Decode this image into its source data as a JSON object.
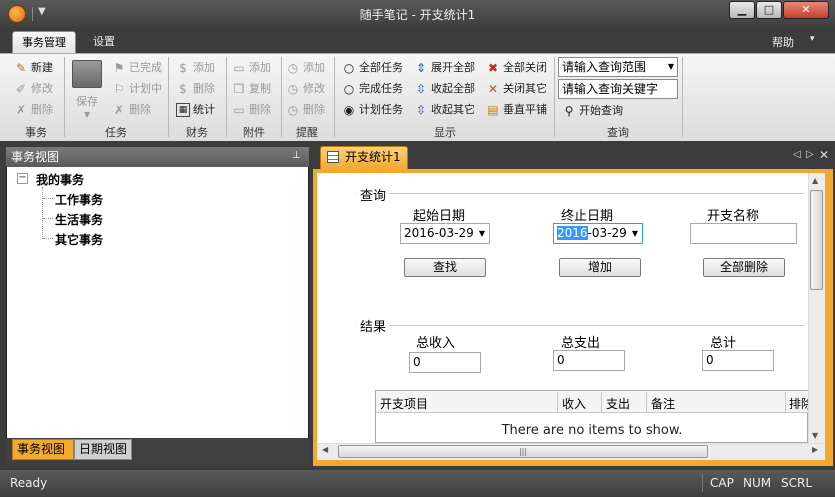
{
  "window": {
    "title": "随手笔记 - 开支统计1"
  },
  "ribbon": {
    "tabs": [
      "事务管理",
      "设置"
    ],
    "help": "帮助",
    "groups": {
      "events": {
        "label": "事务",
        "items": [
          "新建",
          "修改",
          "删除"
        ]
      },
      "tasks": {
        "label": "任务",
        "save": "保存",
        "items": [
          "已完成",
          "计划中",
          "删除"
        ]
      },
      "finance": {
        "label": "财务",
        "items": [
          "添加",
          "删除",
          "统计"
        ]
      },
      "attachments": {
        "label": "附件",
        "items": [
          "添加",
          "复制",
          "删除"
        ]
      },
      "reminders": {
        "label": "提醒",
        "items": [
          "添加",
          "修改",
          "删除"
        ]
      },
      "display": {
        "label": "显示",
        "radios": [
          "全部任务",
          "完成任务",
          "计划任务"
        ],
        "expand": [
          "展开全部",
          "收起全部",
          "收起其它"
        ],
        "window": [
          "全部关闭",
          "关闭其它",
          "垂直平铺"
        ]
      },
      "query": {
        "label": "查询",
        "range_placeholder": "请输入查询范围",
        "keyword_placeholder": "请输入查询关键字",
        "start_query": "开始查询"
      }
    }
  },
  "left_panel": {
    "title": "事务视图",
    "tree": {
      "root": "我的事务",
      "children": [
        "工作事务",
        "生活事务",
        "其它事务"
      ]
    },
    "tabs": [
      "事务视图",
      "日期视图"
    ]
  },
  "document": {
    "tab_title": "开支统计1",
    "query_section": {
      "title": "查询",
      "start_date_label": "起始日期",
      "start_date": "2016-03-29",
      "end_date_label": "终止日期",
      "end_date_year": "2016",
      "end_date_rest": "-03-29",
      "expense_name_label": "开支名称",
      "expense_name_value": "",
      "buttons": [
        "查找",
        "增加",
        "全部删除"
      ]
    },
    "result_section": {
      "title": "结果",
      "total_income_label": "总收入",
      "total_income": "0",
      "total_expense_label": "总支出",
      "total_expense": "0",
      "total_label": "总计",
      "total": "0"
    },
    "grid": {
      "columns": [
        "开支项目",
        "收入",
        "支出",
        "备注",
        "排除"
      ],
      "empty_message": "There are no items to show."
    }
  },
  "statusbar": {
    "text": "Ready",
    "indicators": [
      "CAP",
      "NUM",
      "SCRL"
    ]
  },
  "colors": {
    "accent": "#f2a92f",
    "chrome": "#3c3c3c"
  }
}
